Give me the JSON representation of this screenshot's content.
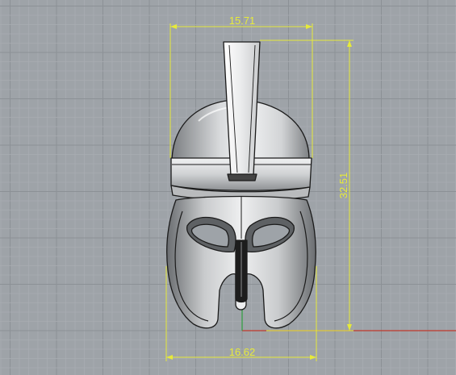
{
  "viewport": {
    "background": "#9ea3a8",
    "grid_minor_color": "#a8adb2",
    "grid_major_color": "#8c9196",
    "axis_x_color": "#c0392b",
    "axis_y_color": "#2e9e3e"
  },
  "model": {
    "name": "helmet",
    "fill_light": "#e9eaeb",
    "fill_dark": "#6b6e71",
    "outline": "#1b1b1b"
  },
  "dimensions": {
    "color": "#e6ea3a",
    "top_width": "15.71",
    "bottom_width": "16.62",
    "height": "32.51"
  }
}
